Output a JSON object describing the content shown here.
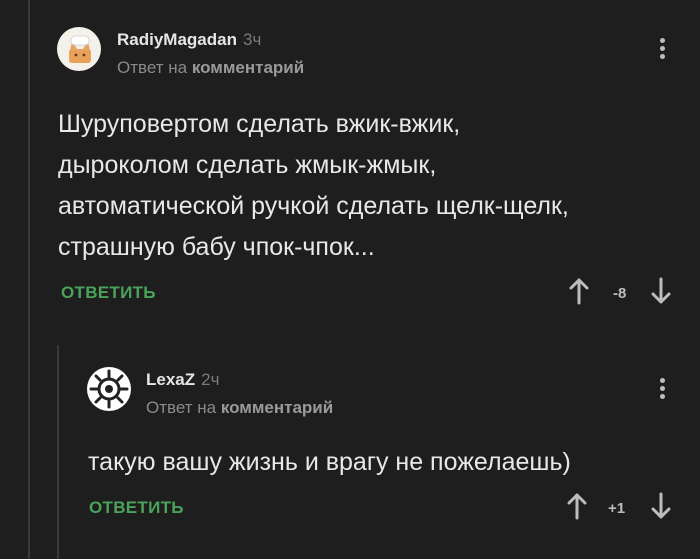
{
  "comments": [
    {
      "author": "RadiyMagadan",
      "time": "3ч",
      "reply_prefix": "Ответ на",
      "reply_link": "комментарий",
      "lines": [
        "Шуруповертом сделать вжик-вжик,",
        "дыроколом сделать жмык-жмык,",
        "автоматической ручкой сделать щелк-щелк,",
        "страшную бабу чпок-чпок..."
      ],
      "reply_label": "ОТВЕТИТЬ",
      "rating": "-8",
      "avatar_icon": "cat-avatar-icon"
    },
    {
      "author": "LexaZ",
      "time": "2ч",
      "reply_prefix": "Ответ на",
      "reply_link": "комментарий",
      "lines": [
        "такую вашу жизнь и врагу не пожелаешь)"
      ],
      "reply_label": "ОТВЕТИТЬ",
      "rating": "+1",
      "avatar_icon": "gear-avatar-icon"
    }
  ],
  "colors": {
    "background": "#1e1e1e",
    "accent_green": "#4aa35a",
    "muted": "#7a7a7a"
  }
}
